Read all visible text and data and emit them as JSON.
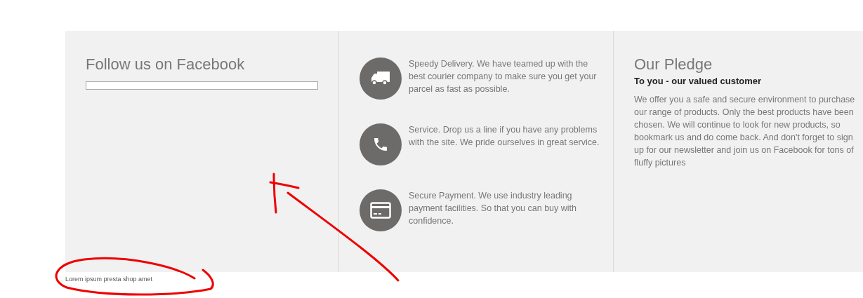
{
  "facebook": {
    "title": "Follow us on Facebook"
  },
  "services": [
    {
      "kind": "truck",
      "text": "Speedy Delivery. We have teamed up with the best courier company to make sure you get your parcel as fast as possible."
    },
    {
      "kind": "phone",
      "text": "Service. Drop us a line if you have any problems with the site. We pride ourselves in great service."
    },
    {
      "kind": "card",
      "text": "Secure Payment. We use industry leading payment facilities. So that you can buy with confidence."
    }
  ],
  "pledge": {
    "title": "Our Pledge",
    "subtitle": "To you - our valued customer",
    "text": "We offer you a safe and secure environment to purchase our range of products. Only the best products have been chosen. We will continue to look for new products, so bookmark us and do come back. And don't forget to sign up for our newsletter and join us on Facebook for tons of fluffy pictures"
  },
  "footer": {
    "text": "Lorem ipsum presta shop amet"
  }
}
